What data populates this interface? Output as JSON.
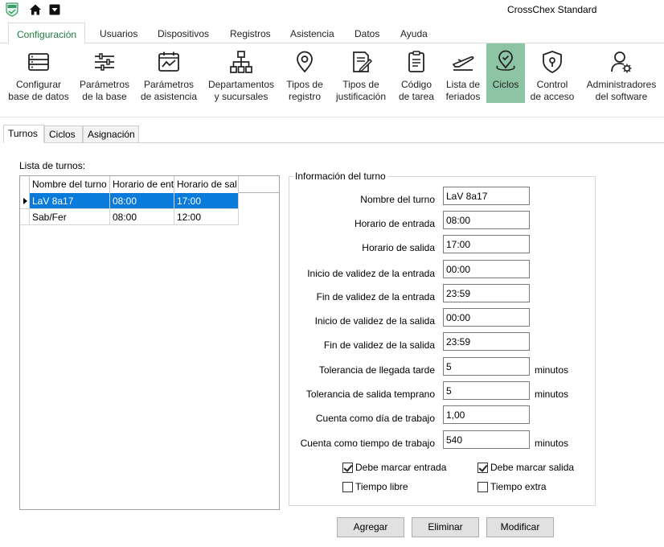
{
  "app": {
    "title": "CrossChex Standard"
  },
  "menu_tabs": [
    {
      "label": "Configuración",
      "active": true
    },
    {
      "label": "Usuarios"
    },
    {
      "label": "Dispositivos"
    },
    {
      "label": "Registros"
    },
    {
      "label": "Asistencia"
    },
    {
      "label": "Datos"
    },
    {
      "label": "Ayuda"
    }
  ],
  "ribbon": [
    {
      "line1": "Configurar",
      "line2": "base de datos",
      "icon": "database-icon"
    },
    {
      "line1": "Parámetros",
      "line2": "de la base",
      "icon": "sliders-icon"
    },
    {
      "line1": "Parámetros",
      "line2": "de asistencia",
      "icon": "attendance-chart-icon"
    },
    {
      "line1": "Departamentos",
      "line2": "y sucursales",
      "icon": "org-chart-icon"
    },
    {
      "line1": "Tipos de",
      "line2": "registro",
      "icon": "location-pin-icon"
    },
    {
      "line1": "Tipos de",
      "line2": "justificación",
      "icon": "edit-document-icon"
    },
    {
      "line1": "Código",
      "line2": "de tarea",
      "icon": "clipboard-icon"
    },
    {
      "line1": "Lista de",
      "line2": "feriados",
      "icon": "holiday-plane-icon"
    },
    {
      "line1": "Ciclos",
      "line2": "",
      "icon": "cycle-pin-icon",
      "active": true
    },
    {
      "line1": "Control",
      "line2": "de acceso",
      "icon": "shield-lock-icon"
    },
    {
      "line1": "Administradores",
      "line2": "del software",
      "icon": "admin-user-gear-icon"
    }
  ],
  "sub_tabs": [
    {
      "label": "Turnos",
      "active": true
    },
    {
      "label": "Ciclos"
    },
    {
      "label": "Asignación"
    }
  ],
  "shift_list": {
    "title": "Lista de turnos:",
    "columns": [
      "Nombre del turno",
      "Horario de ent",
      "Horario de sal"
    ],
    "rows": [
      {
        "name": "LaV 8a17",
        "start": "08:00",
        "end": "17:00",
        "selected": true
      },
      {
        "name": "Sab/Fer",
        "start": "08:00",
        "end": "12:00"
      }
    ]
  },
  "shift_info": {
    "title": "Información del turno",
    "fields": [
      {
        "label": "Nombre del turno",
        "value": "LaV 8a17",
        "unit": ""
      },
      {
        "label": "Horario de entrada",
        "value": "08:00",
        "unit": ""
      },
      {
        "label": "Horario de salida",
        "value": "17:00",
        "unit": ""
      },
      {
        "label": "Inicio de validez de la entrada",
        "value": "00:00",
        "unit": ""
      },
      {
        "label": "Fin de validez de la entrada",
        "value": "23:59",
        "unit": ""
      },
      {
        "label": "Inicio de validez de la salida",
        "value": "00:00",
        "unit": ""
      },
      {
        "label": "Fin de validez de la salida",
        "value": "23:59",
        "unit": ""
      },
      {
        "label": "Tolerancia de llegada tarde",
        "value": "5",
        "unit": "minutos"
      },
      {
        "label": "Tolerancia de salida temprano",
        "value": "5",
        "unit": "minutos"
      },
      {
        "label": "Cuenta como día de trabajo",
        "value": "1,00",
        "unit": ""
      },
      {
        "label": "Cuenta como tiempo de trabajo",
        "value": "540",
        "unit": "minutos"
      }
    ],
    "checkboxes": [
      {
        "label": "Debe marcar entrada",
        "checked": true
      },
      {
        "label": "Debe marcar salida",
        "checked": true
      },
      {
        "label": "Tiempo libre",
        "checked": false
      },
      {
        "label": "Tiempo extra",
        "checked": false
      }
    ]
  },
  "actions": {
    "add": "Agregar",
    "delete": "Eliminar",
    "modify": "Modificar"
  },
  "colors": {
    "active_ribbon": "#8dc5a4",
    "active_tab_text": "#1f7a3d",
    "selection": "#0a7adb"
  }
}
